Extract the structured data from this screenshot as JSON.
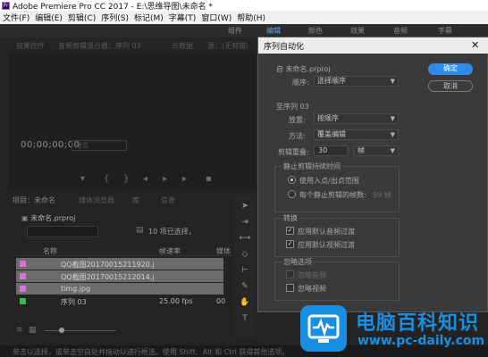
{
  "window": {
    "title": "Adobe Premiere Pro CC 2017 - E:\\思维导图\\未命名 *"
  },
  "menu": [
    "文件(F)",
    "编辑(E)",
    "剪辑(C)",
    "序列(S)",
    "标记(M)",
    "字幕(T)",
    "窗口(W)",
    "帮助(H)"
  ],
  "workspaces": [
    "组件",
    "编辑",
    "颜色",
    "效果",
    "音频",
    "字幕"
  ],
  "source_tabs": [
    "效果控件",
    "音频剪辑混合器：序列 03",
    "元数据",
    "源：(无剪辑)"
  ],
  "monitor": {
    "timecode": "00;00;00;00",
    "fit": "适合"
  },
  "project": {
    "tabs": [
      "项目：未命名",
      "媒体浏览器",
      "库",
      "信息"
    ],
    "file": "未命名.prproj",
    "item_count": "10 项已选择，",
    "columns": [
      "名称",
      "帧速率",
      "媒体"
    ],
    "rows": [
      {
        "name": "QQ截图20170015211920.j",
        "rate": "",
        "media": "",
        "swatch": "#d079d1",
        "selected": true
      },
      {
        "name": "QQ截图20170015212014.j",
        "rate": "",
        "media": "",
        "swatch": "#d079d1",
        "selected": true
      },
      {
        "name": "timg.jpg",
        "rate": "",
        "media": "",
        "swatch": "#d079d1",
        "selected": true
      },
      {
        "name": "序列 03",
        "rate": "25.00 fps",
        "media": "00",
        "swatch": "#3db35a",
        "selected": false
      }
    ]
  },
  "status": "单击以选择，或单击空白处并拖动以进行框选。使用 Shift、Alt 和 Ctrl 获得其他选项。",
  "dialog": {
    "title": "序列自动化",
    "from": "自 未命名.prproj",
    "order_label": "顺序:",
    "order_value": "选择顺序",
    "to": "至序列 03",
    "placement_label": "放置:",
    "placement_value": "按顺序",
    "method_label": "方法:",
    "method_value": "覆盖编辑",
    "overlap_label": "剪辑重叠:",
    "overlap_value": "30",
    "overlap_unit": "帧",
    "still_group": "静止剪辑持续时间",
    "radio_inout": "使用入点/出点范围",
    "radio_frames": "每个静止剪辑的帧数:",
    "frames_value": "99 帧",
    "transition_group": "转换",
    "chk_audio": "应用默认音频过渡",
    "chk_video": "应用默认视频过渡",
    "ignore_group": "忽略选项",
    "chk_ignore_audio": "忽略音频",
    "chk_ignore_video": "忽略视频",
    "ok": "确定",
    "cancel": "取消"
  },
  "watermark": {
    "title": "电脑百科知识",
    "sub": "www.pc-daily.com"
  },
  "colors": {
    "accent": "#2d8ceb",
    "watermark": "#1a8ee0",
    "clip_image": "#d079d1",
    "sequence": "#3db35a"
  }
}
